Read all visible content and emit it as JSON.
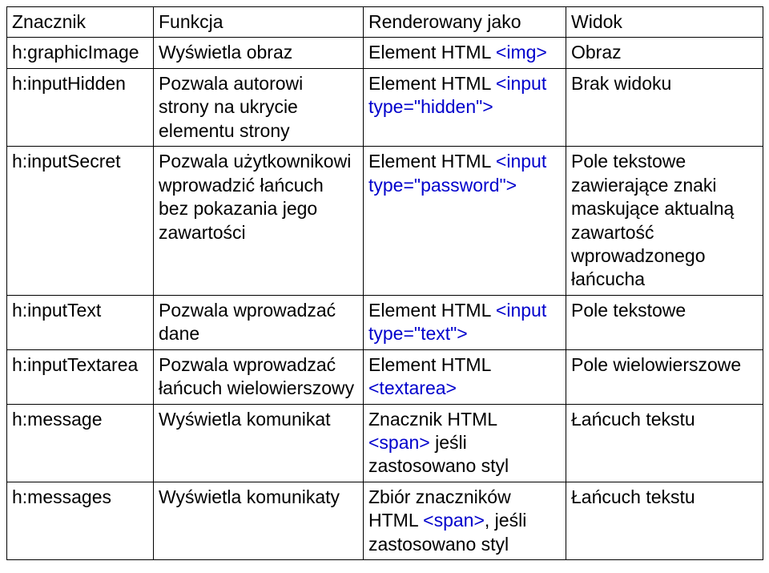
{
  "headers": {
    "c1": "Znacznik",
    "c2": "Funkcja",
    "c3": "Renderowany jako",
    "c4": "Widok"
  },
  "rows": [
    {
      "tag": "h:graphicImage",
      "func": "Wyświetla obraz",
      "rendered_plain": "Element  HTML ",
      "rendered_code": "<img>",
      "view": "Obraz"
    },
    {
      "tag": "h:inputHidden",
      "func": "Pozwala autorowi strony na ukrycie elementu strony",
      "rendered_plain": "Element HTML ",
      "rendered_code": "<input type=\"hidden\">",
      "view": "Brak widoku"
    },
    {
      "tag": "h:inputSecret",
      "func": "Pozwala użytkownikowi wprowadzić łańcuch bez pokazania jego zawartości",
      "rendered_plain": "Element HTML ",
      "rendered_code": "<input type=\"password\">",
      "view": "Pole tekstowe zawierające znaki maskujące aktualną zawartość wprowadzonego łańcucha"
    },
    {
      "tag": "h:inputText",
      "func": "Pozwala wprowadzać dane",
      "rendered_plain": "Element HTML ",
      "rendered_code": "<input type=\"text\">",
      "view": "Pole tekstowe"
    },
    {
      "tag": "h:inputTextarea",
      "func": "Pozwala wprowadzać łańcuch wielowierszowy",
      "rendered_plain": "Element HTML ",
      "rendered_code": "<textarea>",
      "view": "Pole wielowierszowe"
    },
    {
      "tag": "h:message",
      "func": "Wyświetla komunikat",
      "rendered_plain_a": "Znacznik HTML ",
      "rendered_code": "<span>",
      "rendered_plain_b": "  jeśli zastosowano styl",
      "view": "Łańcuch tekstu"
    },
    {
      "tag": "h:messages",
      "func": "Wyświetla komunikaty",
      "rendered_plain_a": "Zbiór znaczników HTML ",
      "rendered_code": "<span>",
      "rendered_plain_b": ", jeśli zastosowano styl",
      "view": "Łańcuch tekstu"
    }
  ]
}
